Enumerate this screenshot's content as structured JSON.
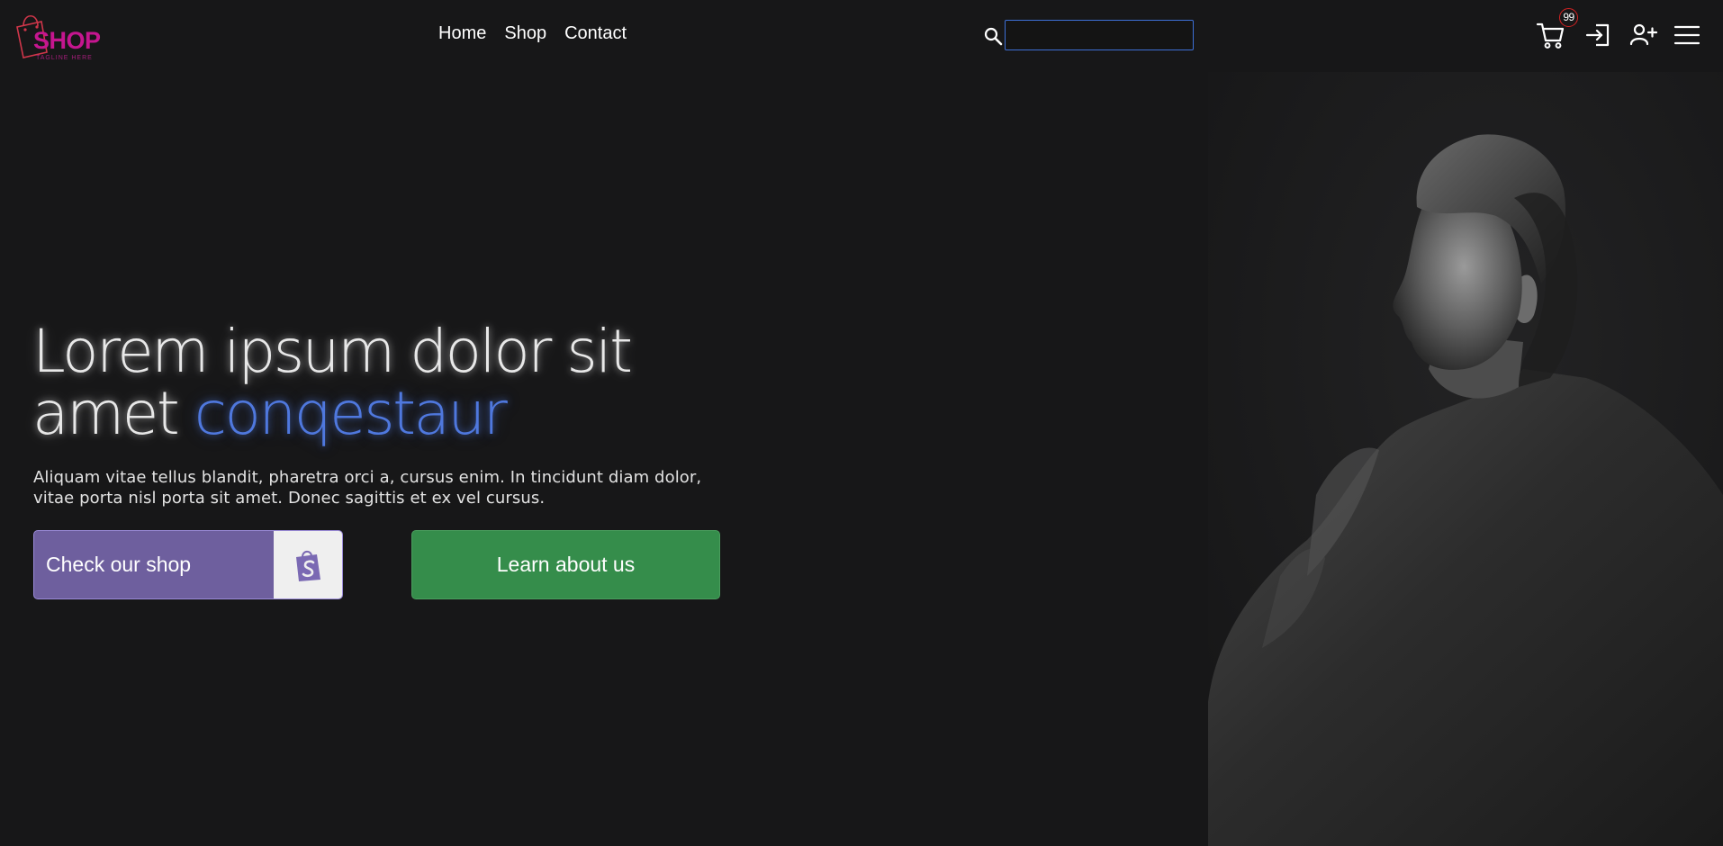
{
  "brand": {
    "name": "SHOP",
    "tagline": "TAGLINE HERE",
    "primary_color": "#c5168f"
  },
  "nav": {
    "links": [
      {
        "label": "Home"
      },
      {
        "label": "Shop"
      },
      {
        "label": "Contact"
      }
    ]
  },
  "search": {
    "icon": "search-icon",
    "value": "",
    "border_color": "#3d6fd6"
  },
  "actions": {
    "cart": {
      "icon": "cart-icon",
      "badge_count": "99"
    },
    "login": {
      "icon": "login-icon"
    },
    "signup": {
      "icon": "user-plus-icon"
    },
    "menu": {
      "icon": "hamburger-menu-icon"
    }
  },
  "hero": {
    "title_main": "Lorem ipsum dolor sit amet ",
    "title_accent": "conqestaur",
    "accent_color": "#4f78de",
    "description": "Aliquam vitae tellus blandit, pharetra orci a, cursus enim. In tincidunt diam dolor, vitae porta nisl porta sit amet. Donec sagittis et ex vel cursus.",
    "primary_button": {
      "label": "Check our shop",
      "icon": "shopify-bag-icon",
      "color": "#6e5f9e"
    },
    "secondary_button": {
      "label": "Learn about us",
      "color": "#358d4b"
    }
  },
  "colors": {
    "background": "#171718"
  }
}
